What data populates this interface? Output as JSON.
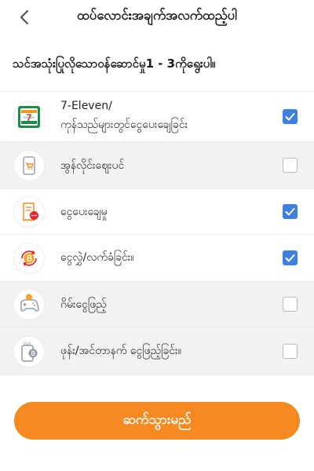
{
  "header": {
    "title": "ထပ်လောင်းအချက်အလက်ထည့်ပါ"
  },
  "subtitle": "သင်အသုံးပြုလိုသောဝန်ဆောင်မှု1 - 3ကိုရွေးပါ။",
  "options": [
    {
      "label_line1": "7-Eleven/",
      "label_line2": "ကုန်သည်များတွင်ငွေပေးချေခြင်း",
      "icon": "seven-eleven-icon",
      "checked": true
    },
    {
      "label": "အွန်လိုင်းဈေးပင်",
      "icon": "online-shopping-icon",
      "checked": false
    },
    {
      "label": "ငွေပေးချေမှု",
      "icon": "bill-payment-icon",
      "checked": true
    },
    {
      "label": "ငွေလွှဲ/လက်ခံခြင်း။",
      "icon": "money-transfer-icon",
      "checked": true
    },
    {
      "label": "ဂိမ်းငွေဖြည့်",
      "icon": "game-topup-icon",
      "checked": false
    },
    {
      "label": "ဖုန်း/အင်တာနက် ငွေဖြည့်ခြင်း။",
      "icon": "phone-topup-icon",
      "checked": false
    }
  ],
  "icon_texts": {
    "seven_eleven_brand": "ELEVEN",
    "seven_eleven_number": "7",
    "true_brand": "true"
  },
  "cta": {
    "label": "ဆက်သွားမည်"
  },
  "colors": {
    "accent": "#f6891f",
    "checkbox_on": "#3f7fe0",
    "row_alt": "#f2f2f4"
  }
}
